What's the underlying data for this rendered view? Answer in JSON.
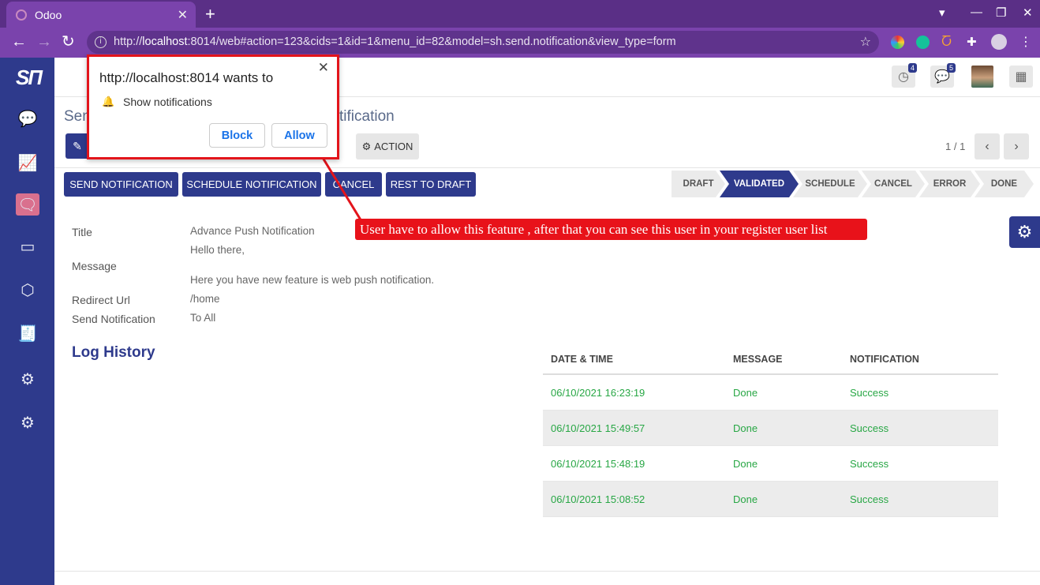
{
  "browser": {
    "tab_title": "Odoo",
    "url_prefix": "http://",
    "url_host": "localhost",
    "url_rest": ":8014/web#action=123&cids=1&id=1&menu_id=82&model=sh.send.notification&view_type=form"
  },
  "topbar": {
    "activity_count": "4",
    "messages_count": "5"
  },
  "breadcrumb": {
    "left": "Sen",
    "right": "tification"
  },
  "control": {
    "action_label": "ACTION",
    "pager": "1 / 1"
  },
  "buttons": {
    "send": "SEND NOTIFICATION",
    "schedule": "SCHEDULE NOTIFICATION",
    "cancel": "CANCEL",
    "reset": "REST TO DRAFT"
  },
  "stages": [
    "DRAFT",
    "VALIDATED",
    "SCHEDULE",
    "CANCEL",
    "ERROR",
    "DONE"
  ],
  "current_stage": "VALIDATED",
  "form": {
    "title_label": "Title",
    "title_value": "Advance Push Notification",
    "message_label": "Message",
    "message_line1": "Hello there,",
    "message_line2": "Here you have new feature is web push notification.",
    "redirect_label": "Redirect Url",
    "redirect_value": "/home",
    "send_label": "Send Notification",
    "send_value": "To All"
  },
  "log": {
    "title": "Log History",
    "columns": [
      "DATE & TIME",
      "MESSAGE",
      "NOTIFICATION"
    ],
    "rows": [
      {
        "date": "06/10/2021 16:23:19",
        "message": "Done",
        "notification": "Success"
      },
      {
        "date": "06/10/2021 15:49:57",
        "message": "Done",
        "notification": "Success"
      },
      {
        "date": "06/10/2021 15:48:19",
        "message": "Done",
        "notification": "Success"
      },
      {
        "date": "06/10/2021 15:08:52",
        "message": "Done",
        "notification": "Success"
      }
    ]
  },
  "popup": {
    "title": "http://localhost:8014 wants to",
    "message": "Show notifications",
    "block": "Block",
    "allow": "Allow"
  },
  "callout": "User have to allow this feature , after that you can see this user in your register user list",
  "colors": {
    "brand": "#2e3a8c",
    "success": "#28a745",
    "highlight": "#e3141b"
  }
}
